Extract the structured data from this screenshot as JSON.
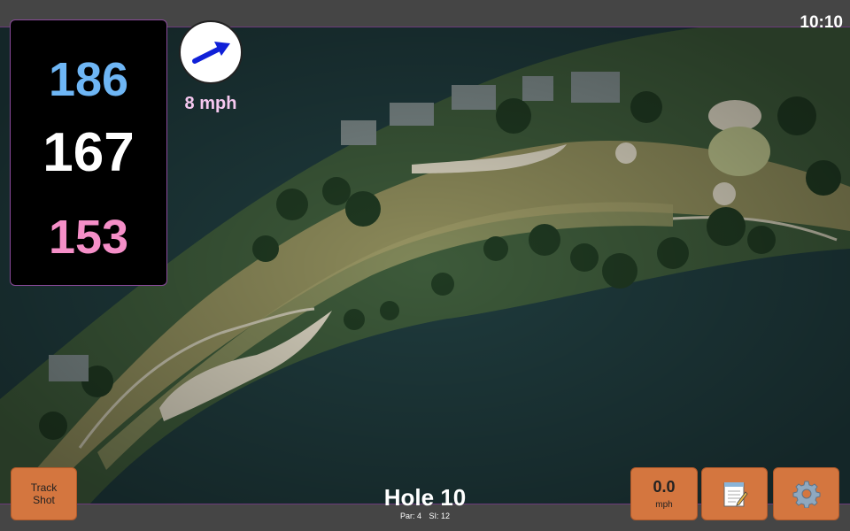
{
  "clock": "10:10",
  "distances": {
    "back": "186",
    "middle": "167",
    "front": "153"
  },
  "wind": {
    "speed": "8 mph",
    "direction_icon": "arrow-icon"
  },
  "hole": {
    "title": "Hole 10",
    "par": "Par: 4",
    "si": "SI: 12"
  },
  "buttons": {
    "track_shot_line1": "Track",
    "track_shot_line2": "Shot",
    "speed_value": "0.0",
    "speed_unit": "mph",
    "notes_icon": "notepad-icon",
    "settings_icon": "gear-icon"
  },
  "colors": {
    "back": "#6eb6f5",
    "middle": "#ffffff",
    "front": "#f58fc8",
    "button": "#d4763f"
  }
}
